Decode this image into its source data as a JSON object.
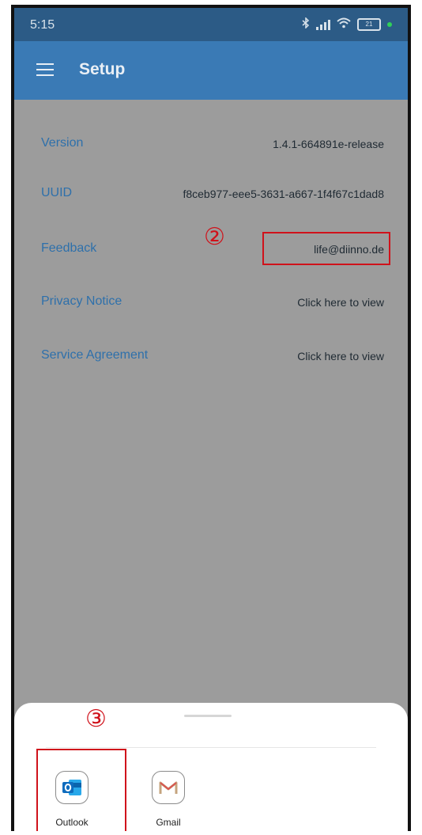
{
  "status_bar": {
    "time": "5:15",
    "battery": "21",
    "bluetooth_icon": "bluetooth-icon",
    "signal_icon": "signal-icon",
    "wifi_icon": "wifi-icon"
  },
  "app_bar": {
    "title": "Setup",
    "menu_icon": "hamburger-menu-icon"
  },
  "settings": [
    {
      "label": "Version",
      "value": "1.4.1-664891e-release"
    },
    {
      "label": "UUID",
      "value": "f8ceb977-eee5-3631-a667-1f4f67c1dad8"
    },
    {
      "label": "Feedback",
      "value": "life@diinno.de"
    },
    {
      "label": "Privacy Notice",
      "value": "Click here to view"
    },
    {
      "label": "Service Agreement",
      "value": "Click here to view"
    }
  ],
  "annotations": {
    "step2": "②",
    "step3": "③"
  },
  "share_sheet": {
    "apps": [
      {
        "label": "Outlook",
        "icon": "outlook-icon"
      },
      {
        "label": "Gmail",
        "icon": "gmail-icon"
      }
    ]
  },
  "colors": {
    "status_bar": "#2c5b86",
    "app_bar": "#3a7ab5",
    "dim_overlay": "#9c9c9c",
    "label_blue": "#2e70ab",
    "annotation_red": "#d0121b"
  }
}
